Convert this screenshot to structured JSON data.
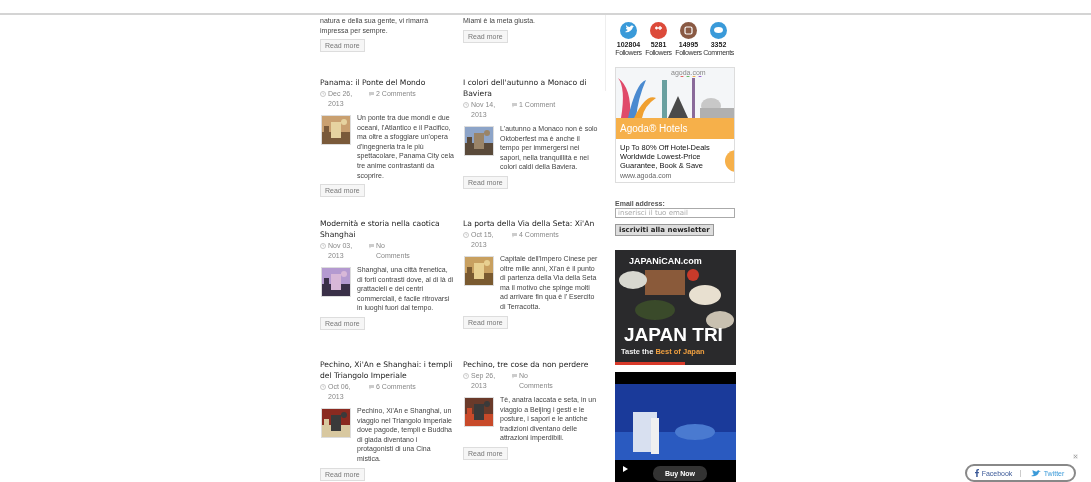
{
  "partial_posts": [
    {
      "excerpt": "natura e della sua gente, vi rimarrà impressa per sempre.",
      "read_more": "Read more"
    },
    {
      "excerpt": "Miami è la meta giusta.",
      "read_more": "Read more"
    }
  ],
  "posts": [
    {
      "title": "Panama: il Ponte del Mondo",
      "date": "Dec 26, 2013",
      "comments": "2 Comments",
      "excerpt": "Un ponte tra due mondi e due oceani, l'Atlantico e il Pacifico, ma oltre a sfoggiare un'opera d'ingegneria tra le più spettacolare, Panama City cela tre anime contrastanti da scoprire.",
      "read_more": "Read more"
    },
    {
      "title": "I colori dell'autunno a Monaco di Baviera",
      "date": "Nov 14, 2013",
      "comments": "1 Comment",
      "excerpt": "L'autunno a Monaco non è solo Oktoberfest ma è anche il tempo per immergersi nei sapori, nella tranquillità e nei colori caldi della Baviera.",
      "read_more": "Read more"
    },
    {
      "title": "Modernità e storia nella caotica Shanghai",
      "date": "Nov 03, 2013",
      "comments": "No Comments",
      "excerpt": "Shanghai, una città frenetica, di forti contrasti dove, al di là di grattacieli e dei centri commerciali, è facile ritrovarsi in luoghi fuori dal tempo.",
      "read_more": "Read more"
    },
    {
      "title": "La porta della Via della Seta: Xi'An",
      "date": "Oct 15, 2013",
      "comments": "4 Comments",
      "excerpt": "Capitale dell'Impero Cinese per oltre mille anni, Xi'an è il punto di partenza della Via della Seta ma il motivo che spinge molti ad arrivare fin qua è l' Esercito di Terracotta.",
      "read_more": "Read more"
    },
    {
      "title": "Pechino, Xi'An e Shanghai: i templi del Triangolo Imperiale",
      "date": "Oct 06, 2013",
      "comments": "6 Comments",
      "excerpt": "Pechino, Xi'An e Shanghai, un viaggio nel Triangolo Imperiale dove pagode, templi e Buddha di giada diventano i protagonisti di una Cina mistica.",
      "read_more": "Read more"
    },
    {
      "title": "Pechino, tre cose da non perdere",
      "date": "Sep 26, 2013",
      "comments": "No Comments",
      "excerpt": "Tè, anatra laccata e seta, in un viaggio a Beijing i gesti e le posture, i sapori e le antiche tradizioni diventano delle attrazioni imperdibili.",
      "read_more": "Read more"
    }
  ],
  "social_counts": [
    {
      "kind": "twitter",
      "count": "102804",
      "label": "Followers"
    },
    {
      "kind": "googleplus",
      "count": "5281",
      "label": "Followers"
    },
    {
      "kind": "instagram",
      "count": "14995",
      "label": "Followers"
    },
    {
      "kind": "comments",
      "count": "3352",
      "label": "Comments"
    }
  ],
  "agoda_ad": {
    "domain": "agoda.com",
    "title": "Agoda® Hotels",
    "body": "Up To 80% Off Hotel-Deals Worldwide Lowest-Price Guarantee, Book & Save",
    "footer": "www.agoda.com"
  },
  "newsletter": {
    "label": "Email address:",
    "placeholder": "inserisci il tuo email",
    "button": "iscriviti alla newsletter"
  },
  "japanican_ad": {
    "brand": "JAPANiCAN.com",
    "headline": "JAPAN TRI",
    "tagline": "Taste the **Best of Japan**"
  },
  "video_ad": {
    "button": "Buy Now"
  },
  "share_bar": {
    "buttons": [
      {
        "kind": "facebook",
        "label": "Facebook"
      },
      {
        "kind": "twitter",
        "label": "Twitter"
      }
    ]
  }
}
